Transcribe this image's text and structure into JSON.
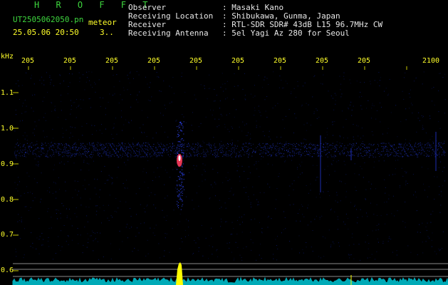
{
  "header": {
    "logo": "H R O F F T",
    "filename": "UT2505062050.pn",
    "event": "meteor",
    "datetime": "25.05.06 20:50",
    "extra": "3..",
    "fields": [
      {
        "label": "Observer",
        "value": ": Masaki Kano"
      },
      {
        "label": "Receiving Location",
        "value": ": Shibukawa, Gunma, Japan"
      },
      {
        "label": "Receiver",
        "value": ": RTL-SDR SDR# 43dB L15 96.7MHz CW"
      },
      {
        "label": "Receiving Antenna",
        "value": ": 5el Yagi Az 280 for Seoul"
      }
    ]
  },
  "axes": {
    "y_unit": "kHz",
    "y_ticks": [
      "1.1",
      "1.0",
      "0.9",
      "0.8",
      "0.7",
      "0.6"
    ],
    "x_ticks": [
      "205",
      "205",
      "205",
      "205",
      "205",
      "205",
      "205",
      "205",
      "205",
      "2100"
    ]
  },
  "colors": {
    "background": "#000000",
    "grid": "#c8c800",
    "band": "#1a2aa0",
    "signal_hot": "#ff3a5a",
    "signal_core": "#ffffff",
    "noise": "#00c8d8",
    "spike": "#ffff00"
  }
}
